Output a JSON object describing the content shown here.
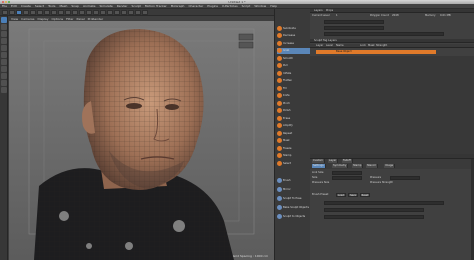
{
  "window": {
    "title": "Untitled 1 *"
  },
  "menu": [
    "File",
    "Edit",
    "Create",
    "Select",
    "Tools",
    "Mesh",
    "Snap",
    "Animate",
    "Simulate",
    "Render",
    "Sculpt",
    "Motion Tracker",
    "MoGraph",
    "Character",
    "Plugins",
    "X-Particles",
    "Script",
    "Window",
    "Help"
  ],
  "viewport": {
    "menu": [
      "View",
      "Cameras",
      "Display",
      "Options",
      "Filter",
      "Panel",
      "ProRender"
    ],
    "grid_spacing": "Grid Spacing : 1000 cm"
  },
  "sculpt_tools": [
    "Subdivide",
    "Decrease",
    "Increase",
    "Grab",
    "Smooth",
    "Pull",
    "Inflate",
    "Flatten",
    "Fill",
    "Knife",
    "Pinch",
    "Polish",
    "Erase",
    "Amplify",
    "Repeat",
    "Mask",
    "Freeze",
    "Stamp",
    "Select"
  ],
  "lower_tools": [
    "Brush",
    "Mirror",
    "Sculpt To Pose",
    "Bake Sculpt Objects",
    "Sculpt to Objects"
  ],
  "layers_panel": {
    "header": [
      "Layers",
      "Props"
    ],
    "rows_labels": [
      "Current Level",
      "Polygon Count",
      "Memory"
    ],
    "values": [
      "1",
      "2048",
      "0.01 MB"
    ],
    "section": "Sculpt Tag Layers",
    "columns": [
      "Layer",
      "Level",
      "Name",
      "Lock",
      "Mask",
      "Strength"
    ],
    "base_layer": "Base Object"
  },
  "attributes": {
    "tabs": [
      "Settings",
      "Symmetry",
      "Stamp",
      "Stencil",
      "Image"
    ],
    "subtabs": [
      "Custom",
      "Layer",
      "Falloff"
    ],
    "brush_label": "Brush Preset",
    "buttons": [
      "Load",
      "Save",
      "Reset"
    ],
    "rows": [
      "Link Size",
      "Size",
      "Pressure",
      "Pressure Size",
      "Pressure Strength"
    ]
  }
}
